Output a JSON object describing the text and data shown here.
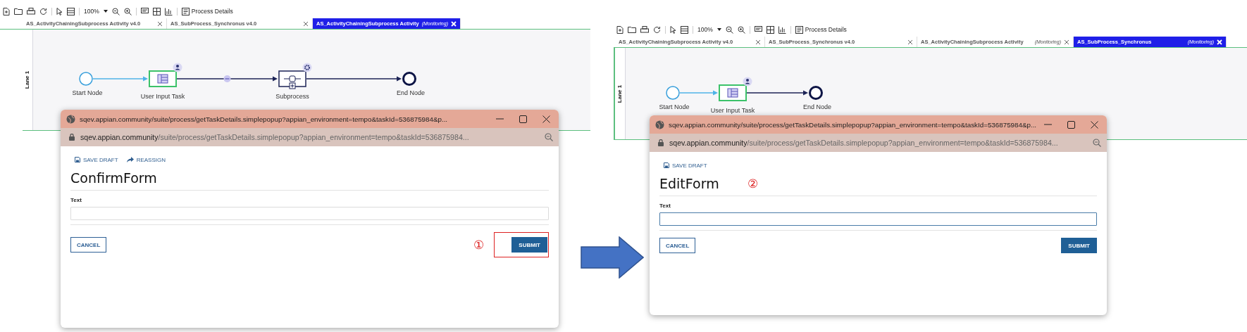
{
  "screens": [
    {
      "toolbar": {
        "zoom": "100%",
        "title": "Process Details"
      },
      "tabs": [
        {
          "label": "AS_ActivityChainingSubprocess Activity v4.0",
          "selected": false
        },
        {
          "label": "AS_SubProcess_Synchronus v4.0",
          "selected": false
        },
        {
          "label": "AS_ActivityChainingSubprocess Activity",
          "status": "(Monitoring)",
          "selected": true
        }
      ],
      "lane": "Lane 1",
      "nodes": [
        {
          "kind": "start",
          "label": "Start Node"
        },
        {
          "kind": "task",
          "label": "User Input Task"
        },
        {
          "kind": "subprocess",
          "label": "Subprocess"
        },
        {
          "kind": "end",
          "label": "End Node"
        }
      ],
      "edges": [
        {
          "kind": "active"
        },
        {
          "kind": "chained"
        },
        {
          "kind": "normal"
        }
      ],
      "popup": {
        "title": "sqev.appian.community/suite/process/getTaskDetails.simplepopup?appian_environment=tempo&taskId=536875984&p...",
        "host": "sqev.appian.community",
        "path": "/suite/process/getTaskDetails.simplepopup?appian_environment=tempo&taskId=536875984...",
        "actions": [
          {
            "kind": "save",
            "label": "SAVE DRAFT"
          },
          {
            "kind": "reassign",
            "label": "REASSIGN"
          }
        ],
        "heading": "ConfirmForm",
        "field_label": "Text",
        "field_focused": false,
        "cancel": "CANCEL",
        "submit": "SUBMIT"
      },
      "annotation": {
        "kind": "submit",
        "number": "①",
        "highlight": true
      }
    },
    {
      "toolbar": {
        "zoom": "100%",
        "title": "Process Details"
      },
      "tabs": [
        {
          "label": "AS_ActivityChainingSubprocess Activity v4.0",
          "selected": false
        },
        {
          "label": "AS_SubProcess_Synchronus v4.0",
          "selected": false
        },
        {
          "label": "AS_ActivityChainingSubprocess Activity",
          "status": "(Monitoring)",
          "selected": false
        },
        {
          "label": "AS_SubProcess_Synchronus",
          "status": "(Monitoring)",
          "selected": true
        }
      ],
      "lane": "Lane 1",
      "nodes": [
        {
          "kind": "start",
          "label": "Start Node"
        },
        {
          "kind": "task",
          "label": "User Input Task"
        },
        {
          "kind": "end",
          "label": "End Node"
        }
      ],
      "edges": [
        {
          "kind": "active"
        },
        {
          "kind": "normal"
        }
      ],
      "popup": {
        "title": "sqev.appian.community/suite/process/getTaskDetails.simplepopup?appian_environment=tempo&taskId=536875984&p...",
        "host": "sqev.appian.community",
        "path": "/suite/process/getTaskDetails.simplepopup?appian_environment=tempo&taskId=536875984...",
        "actions": [
          {
            "kind": "save",
            "label": "SAVE DRAFT"
          }
        ],
        "heading": "EditForm",
        "field_label": "Text",
        "field_focused": true,
        "cancel": "CANCEL",
        "submit": "SUBMIT"
      },
      "annotation": {
        "kind": "heading",
        "number": "②",
        "highlight": false
      }
    }
  ]
}
